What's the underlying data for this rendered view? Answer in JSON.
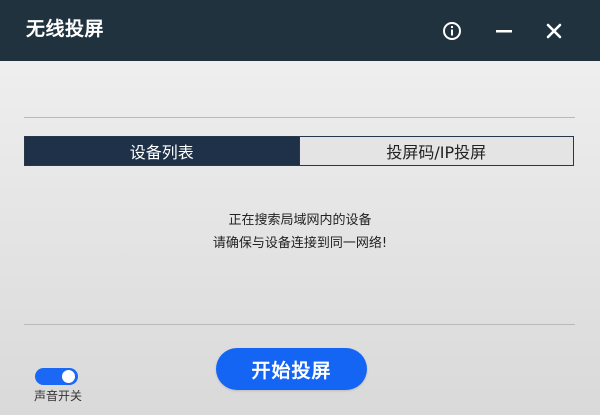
{
  "window": {
    "title": "无线投屏"
  },
  "titlebar": {
    "buttons": [
      {
        "name": "info",
        "icon": "info-icon"
      },
      {
        "name": "minimize",
        "icon": "minimize-icon"
      },
      {
        "name": "close",
        "icon": "close-icon"
      }
    ]
  },
  "tabs": [
    {
      "label": "设备列表",
      "active": true
    },
    {
      "label": "投屏码/IP投屏",
      "active": false
    }
  ],
  "status": {
    "line1": "正在搜索局域网内的设备",
    "line2": "请确保与设备连接到同一网络!"
  },
  "start_button": {
    "label": "开始投屏"
  },
  "sound": {
    "label": "声音开关",
    "enabled": true
  },
  "colors": {
    "titlebar_bg": "#21323f",
    "tab_active_bg": "#1f3148",
    "accent": "#1565f5"
  }
}
